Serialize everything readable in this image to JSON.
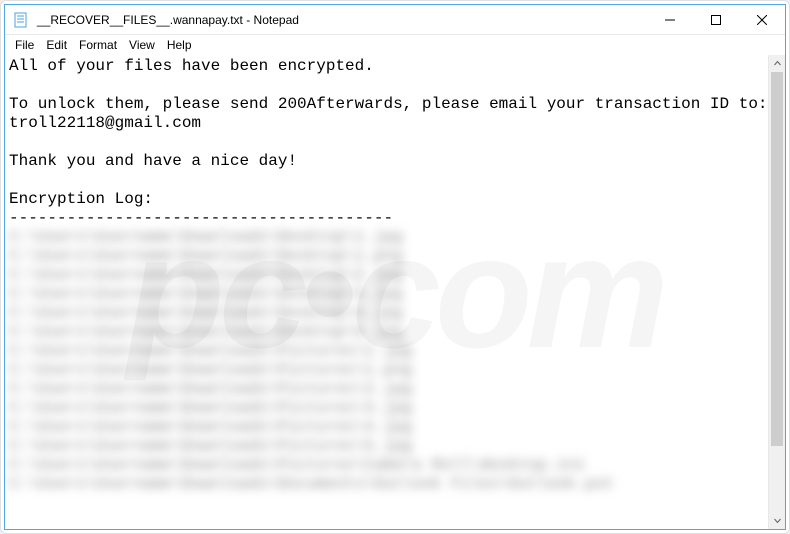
{
  "window": {
    "title": "__RECOVER__FILES__.wannapay.txt - Notepad"
  },
  "menu": {
    "file": "File",
    "edit": "Edit",
    "format": "Format",
    "view": "View",
    "help": "Help"
  },
  "body": {
    "line1": "All of your files have been encrypted.",
    "line2": "",
    "line3": "To unlock them, please send 200Afterwards, please email your transaction ID to:",
    "line4": "troll22118@gmail.com",
    "line5": "",
    "line6": "Thank you and have a nice day!",
    "line7": "",
    "line8": "Encryption Log:",
    "line9": "----------------------------------------"
  },
  "encryption_log": [
    "C:\\Users\\Username\\Downloads\\Desktop\\1.jpg",
    "C:\\Users\\Username\\Downloads\\Desktop\\1.png",
    "C:\\Users\\Username\\Downloads\\Desktop\\2.jpg",
    "C:\\Users\\Username\\Downloads\\Desktop\\3.jpg",
    "C:\\Users\\Username\\Downloads\\Desktop\\4.jpg",
    "C:\\Users\\Username\\Downloads\\Desktop\\5.jpg",
    "C:\\Users\\Username\\Downloads\\Pictures\\1.jpg",
    "C:\\Users\\Username\\Downloads\\Pictures\\1.png",
    "C:\\Users\\Username\\Downloads\\Pictures\\2.jpg",
    "C:\\Users\\Username\\Downloads\\Pictures\\3.jpg",
    "C:\\Users\\Username\\Downloads\\Pictures\\4.jpg",
    "C:\\Users\\Username\\Downloads\\Pictures\\5.jpg",
    "C:\\Users\\Username\\Downloads\\Pictures\\Camera Roll\\desktop.ini",
    "C:\\Users\\Username\\Downloads\\Documents\\Outlook Files\\Outlook.pst"
  ],
  "watermark": {
    "text_left": "pc",
    "text_right": "com",
    "dot": "•"
  }
}
